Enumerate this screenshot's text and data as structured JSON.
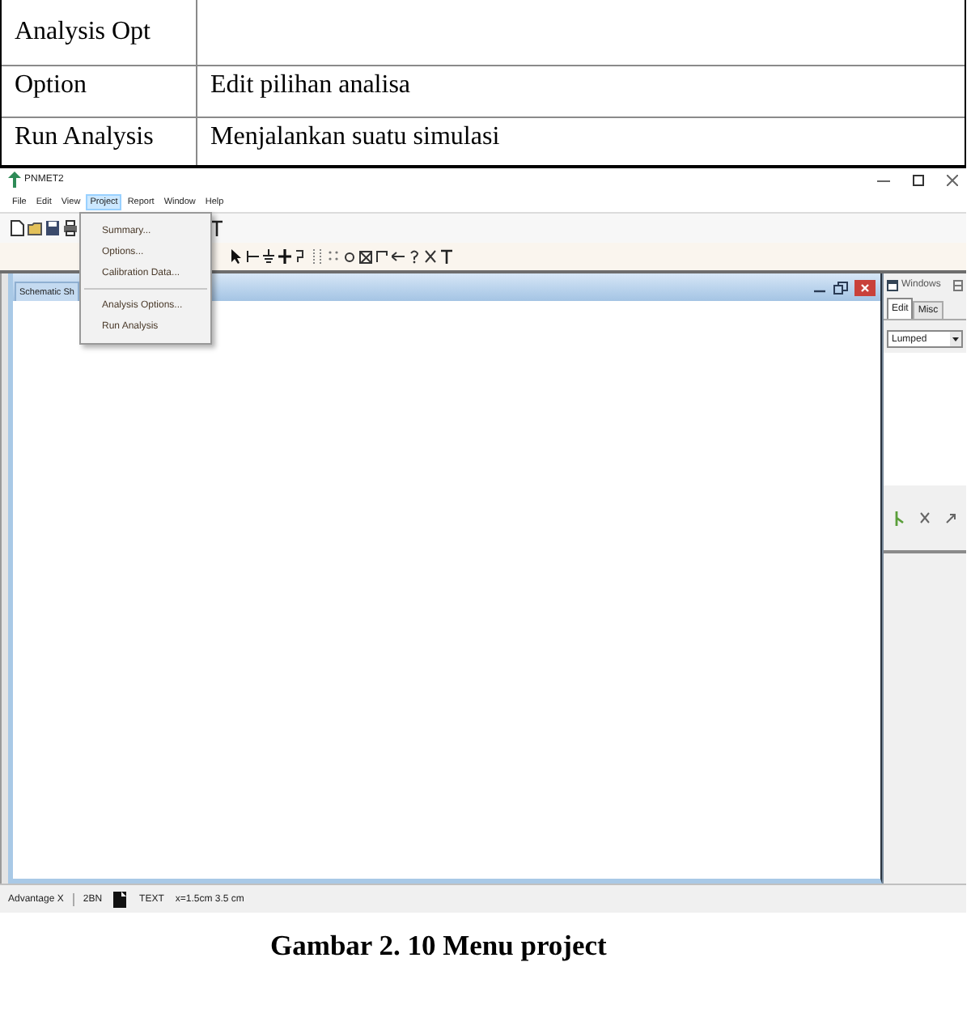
{
  "table": {
    "rows": [
      {
        "column_1": "Analysis Opt"
      },
      {
        "column_1": "Option",
        "column_2": "Edit pilihan analisa"
      },
      {
        "column_1": "Run Analysis",
        "column_2": "Menjalankan suatu simulasi"
      }
    ]
  },
  "app": {
    "window": {
      "title": "PNMET2"
    },
    "menu_bar": [
      {
        "label": "File",
        "selected": false
      },
      {
        "label": "Edit",
        "selected": false
      },
      {
        "label": "View",
        "selected": false
      },
      {
        "label": "Project",
        "selected": true
      },
      {
        "label": "Report",
        "selected": false
      },
      {
        "label": "Window",
        "selected": false
      },
      {
        "label": "Help",
        "selected": false
      }
    ],
    "open_menu": {
      "items": [
        {
          "kind": "item",
          "label": "Summary..."
        },
        {
          "kind": "item",
          "label": "Options..."
        },
        {
          "kind": "item",
          "label": "Calibration Data..."
        },
        {
          "kind": "separator"
        },
        {
          "kind": "item",
          "label": "Analysis Options..."
        },
        {
          "kind": "item",
          "label": "Run Analysis"
        }
      ]
    },
    "document_window": {
      "title": "Schematic Sh"
    },
    "side_panel": {
      "title": "Windows",
      "tabs": [
        {
          "label": "Edit",
          "selected": true
        },
        {
          "label": "Misc",
          "selected": false
        }
      ],
      "dropdown": {
        "value": "Lumped"
      }
    },
    "status_bar": [
      "Advantage X",
      "2BN",
      "TEXT",
      "x=1.5cm 3.5 cm"
    ]
  },
  "caption": "Gambar 2. 10 Menu project"
}
